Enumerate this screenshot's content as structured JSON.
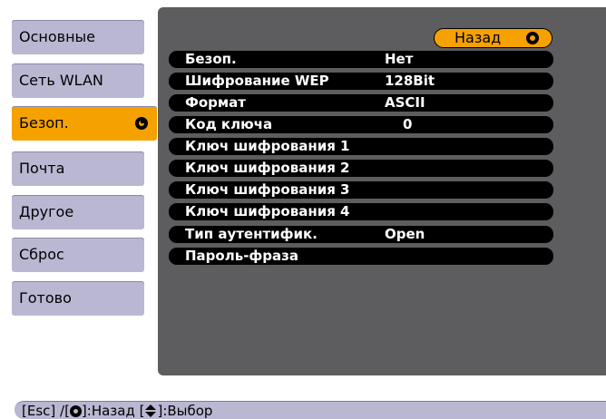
{
  "sidebar": {
    "items": [
      {
        "label": "Основные"
      },
      {
        "label": "Сеть WLAN"
      },
      {
        "label": "Безоп."
      },
      {
        "label": "Почта"
      },
      {
        "label": "Другое"
      },
      {
        "label": "Сброс"
      },
      {
        "label": "Готово"
      }
    ],
    "selected_index": 2
  },
  "panel": {
    "back_label": "Назад",
    "rows": [
      {
        "label": "Безоп.",
        "value": "Нет"
      },
      {
        "label": "Шифрование WEP",
        "value": "128Bit"
      },
      {
        "label": "Формат",
        "value": "ASCII"
      },
      {
        "label": "Код ключа",
        "value": "0"
      },
      {
        "label": "Ключ шифрования 1",
        "value": ""
      },
      {
        "label": "Ключ шифрования 2",
        "value": ""
      },
      {
        "label": "Ключ шифрования 3",
        "value": ""
      },
      {
        "label": "Ключ шифрования 4",
        "value": ""
      },
      {
        "label": "Тип аутентифик.",
        "value": "Open"
      },
      {
        "label": "Пароль-фраза",
        "value": ""
      }
    ]
  },
  "statusbar": {
    "part1": "[Esc] /[",
    "part2": "]:Назад  [",
    "part3": "]:Выбор"
  },
  "colors": {
    "accent": "#f5a100",
    "menu": "#bab7d3",
    "panel": "#5d5d5f"
  }
}
